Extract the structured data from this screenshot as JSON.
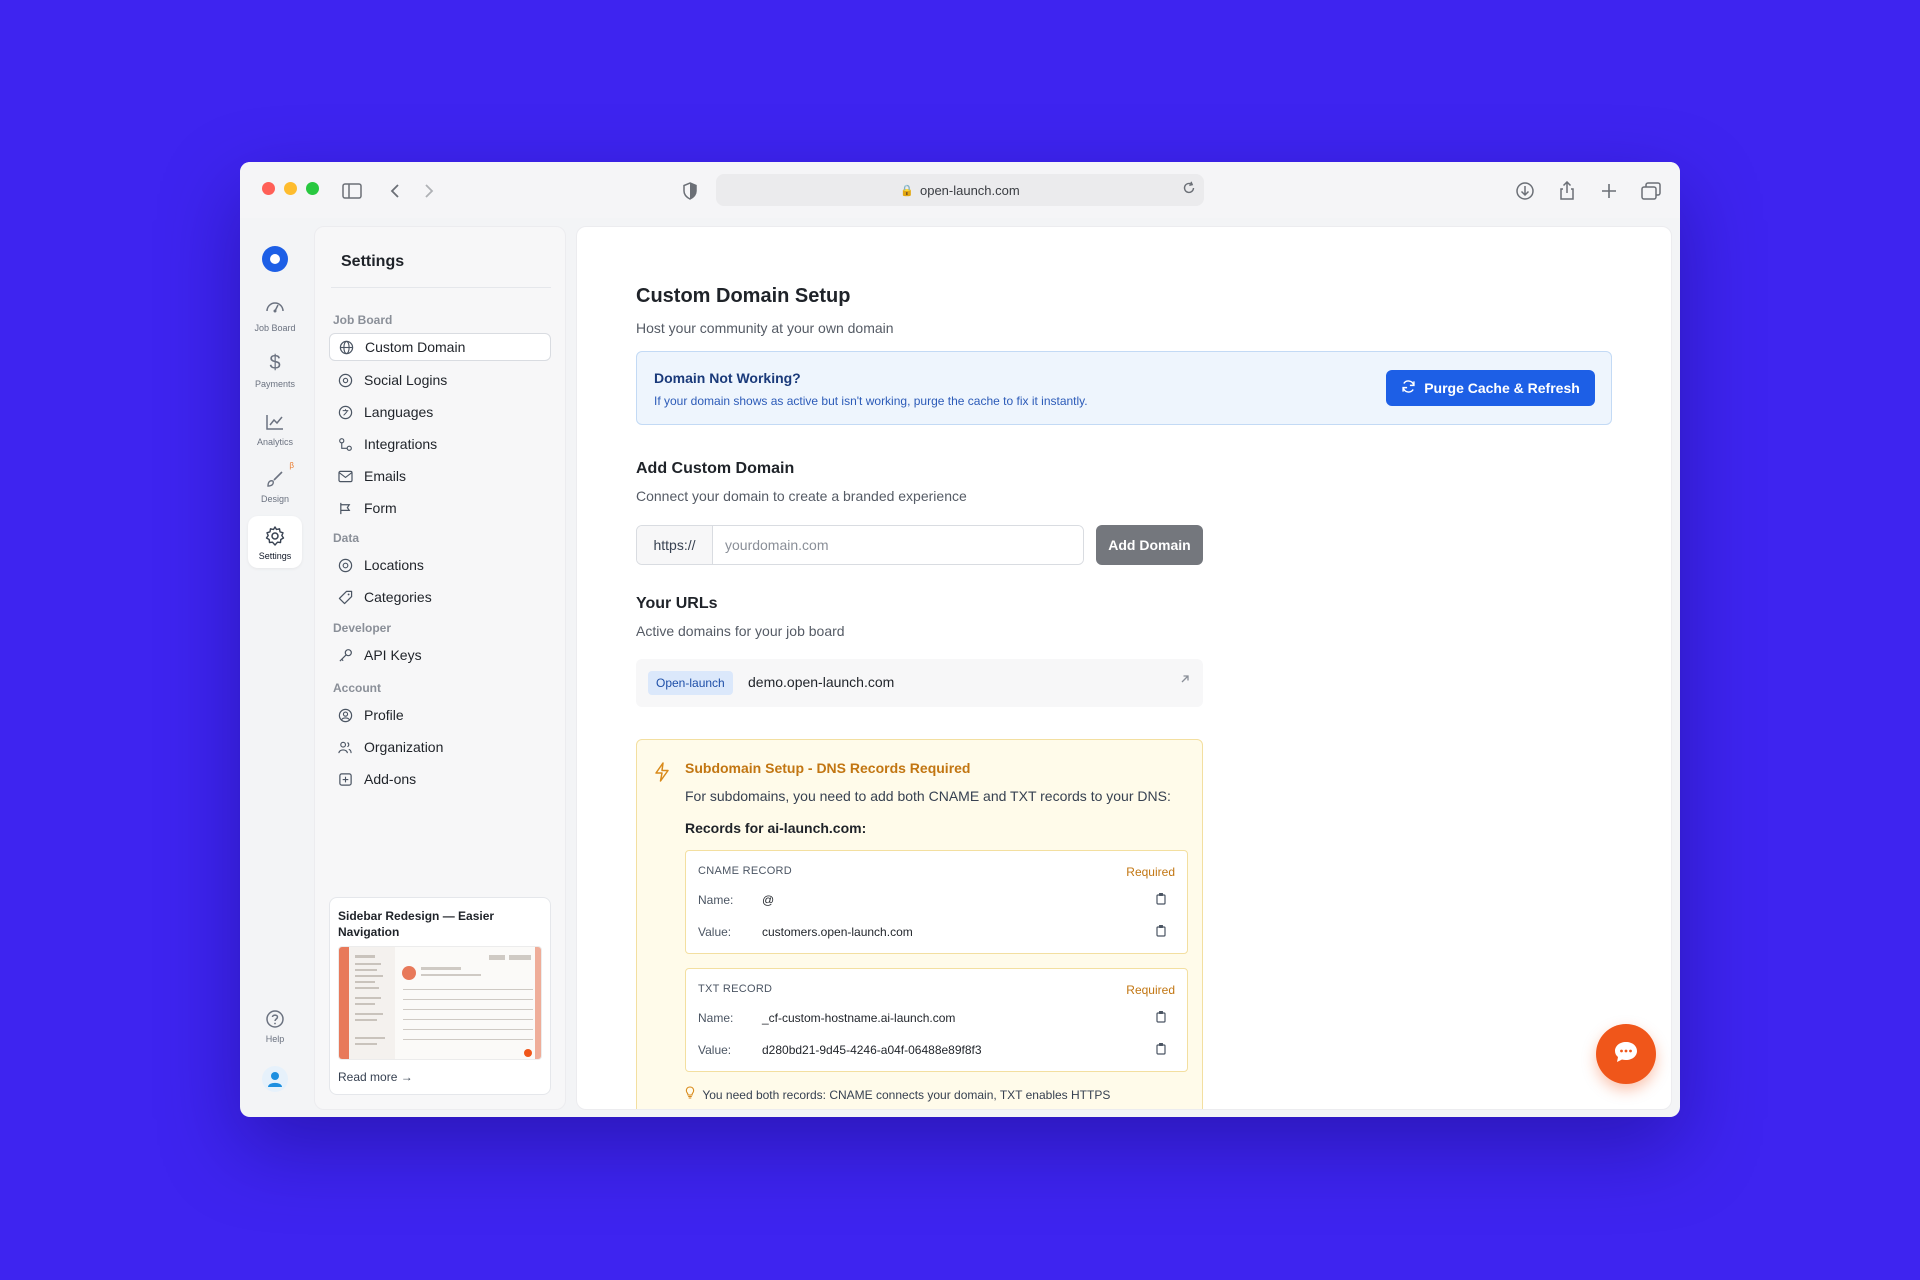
{
  "browser": {
    "url": "open-launch.com"
  },
  "rail": {
    "items": [
      {
        "label": "Job Board",
        "icon": "job-board-icon"
      },
      {
        "label": "Payments",
        "icon": "dollar-icon"
      },
      {
        "label": "Analytics",
        "icon": "chart-icon"
      },
      {
        "label": "Design",
        "icon": "brush-icon",
        "badge": "β"
      },
      {
        "label": "Settings",
        "icon": "gear-icon",
        "active": true
      }
    ],
    "help_label": "Help"
  },
  "menu": {
    "title": "Settings",
    "groups": [
      {
        "label": "Job Board",
        "items": [
          "Custom Domain",
          "Social Logins",
          "Languages",
          "Integrations",
          "Emails",
          "Form"
        ]
      },
      {
        "label": "Data",
        "items": [
          "Locations",
          "Categories"
        ]
      },
      {
        "label": "Developer",
        "items": [
          "API Keys"
        ]
      },
      {
        "label": "Account",
        "items": [
          "Profile",
          "Organization",
          "Add-ons"
        ]
      }
    ],
    "promo": {
      "title": "Sidebar Redesign — Easier Navigation",
      "link": "Read more →"
    }
  },
  "main": {
    "title": "Custom Domain Setup",
    "subtitle": "Host your community at your own domain",
    "alert": {
      "title": "Domain Not Working?",
      "body": "If your domain shows as active but isn't working, purge the cache to fix it instantly.",
      "button": "Purge Cache & Refresh"
    },
    "add": {
      "title": "Add Custom Domain",
      "subtitle": "Connect your domain to create a branded experience",
      "prefix": "https://",
      "placeholder": "yourdomain.com",
      "button": "Add Domain"
    },
    "urls": {
      "title": "Your URLs",
      "subtitle": "Active domains for your job board",
      "badge": "Open-launch",
      "domain": "demo.open-launch.com"
    },
    "dns": {
      "title": "Subdomain Setup - DNS Records Required",
      "text": "For subdomains, you need to add both CNAME and TXT records to your DNS:",
      "records_for": "Records for ai-launch.com:",
      "cname": {
        "title": "CNAME RECORD",
        "required": "Required",
        "name_key": "Name:",
        "name": "@",
        "value_key": "Value:",
        "value": "customers.open-launch.com"
      },
      "txt": {
        "title": "TXT RECORD",
        "required": "Required",
        "name_key": "Name:",
        "name": "_cf-custom-hostname.ai-launch.com",
        "value_key": "Value:",
        "value": "d280bd21-9d45-4246-a04f-06488e89f8f3"
      },
      "note": "You need both records: CNAME connects your domain, TXT enables HTTPS"
    }
  },
  "colors": {
    "background": "#3e24f0",
    "primary": "#1d5fe6",
    "warning": "#c27612",
    "chat": "#f0561a"
  }
}
